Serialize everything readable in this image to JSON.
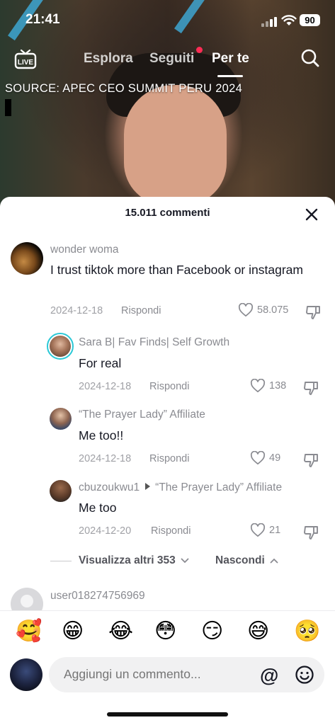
{
  "status": {
    "time": "21:41",
    "battery": "90"
  },
  "nav": {
    "live_label": "LIVE",
    "tabs": [
      {
        "label": "Esplora"
      },
      {
        "label": "Seguiti"
      },
      {
        "label": "Per te"
      }
    ]
  },
  "video": {
    "source_text": "SOURCE: APEC CEO SUMMIT PERU 2024"
  },
  "comments_panel": {
    "title": "15.011 commenti",
    "comments": [
      {
        "username": "wonder woma",
        "text": "I trust tiktok more than Facebook or instagram",
        "date": "2024-12-18",
        "reply_label": "Rispondi",
        "likes": "58.075"
      },
      {
        "username": "Sara B| Fav Finds| Self Growth",
        "text": "For real",
        "date": "2024-12-18",
        "reply_label": "Rispondi",
        "likes": "138"
      },
      {
        "username": "“The Prayer Lady” Affiliate",
        "text": "Me too!!",
        "date": "2024-12-18",
        "reply_label": "Rispondi",
        "likes": "49"
      },
      {
        "username": "cbuzoukwu1",
        "reply_to": "“The Prayer Lady” Affiliate",
        "text": "Me too",
        "date": "2024-12-20",
        "reply_label": "Rispondi",
        "likes": "21"
      },
      {
        "username": "user018274756969"
      }
    ],
    "view_more_label": "Visualizza altri 353",
    "hide_label": "Nascondi"
  },
  "composer": {
    "emojis": [
      "🥰",
      "😁",
      "😂",
      "😳",
      "😏",
      "😅",
      "🥺"
    ],
    "placeholder": "Aggiungi un commento...",
    "at_label": "@"
  },
  "colors": {
    "accent": "#fe2c55",
    "story_ring": "#2bc8d6",
    "text": "#161823",
    "muted": "#8a8b91"
  }
}
